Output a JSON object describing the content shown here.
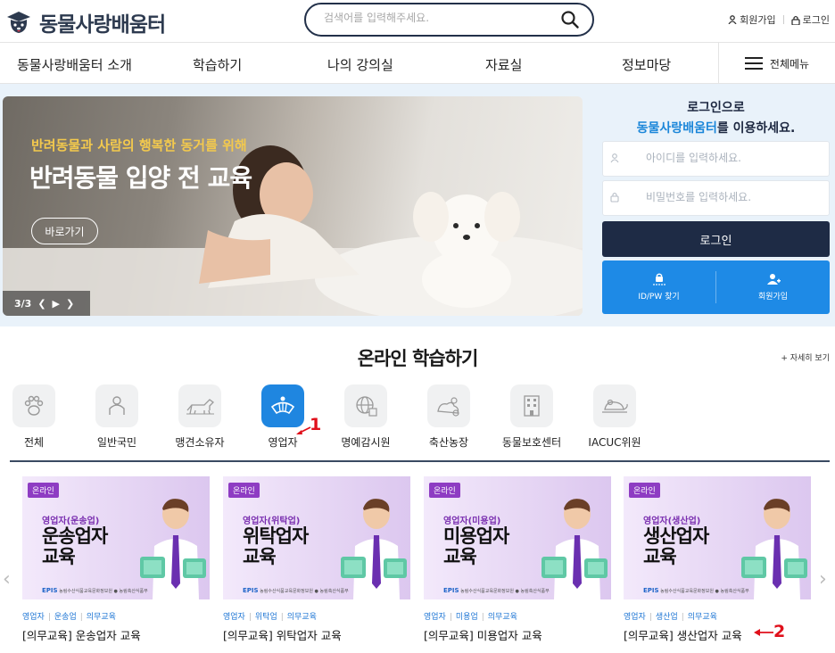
{
  "header": {
    "site_name": "동물사랑배움터",
    "search_placeholder": "검색어를 입력해주세요.",
    "util": [
      {
        "label": "회원가입",
        "icon": "person-icon"
      },
      {
        "label": "로그인",
        "icon": "lock-icon"
      }
    ]
  },
  "gnb": {
    "items": [
      "동물사랑배움터 소개",
      "학습하기",
      "나의 강의실",
      "자료실",
      "정보마당"
    ],
    "all_menu": "전체메뉴"
  },
  "banner": {
    "subtitle": "반려동물과 사람의 행복한 동거를 위해",
    "title": "반려동물 입양 전 교육",
    "go_label": "바로가기",
    "pager": "3/3"
  },
  "login": {
    "heading1": "로그인으로",
    "heading2_brand": "동물사랑배움터",
    "heading2_rest": "를 이용하세요.",
    "id_placeholder": "아이디를 입력하세요.",
    "pw_placeholder": "비밀번호를 입력하세요.",
    "login_button": "로그인",
    "find_label": "ID/PW 찾기",
    "join_label": "회원가입"
  },
  "online": {
    "title": "온라인 학습하기",
    "more": "+ 자세히 보기",
    "categories": [
      {
        "label": "전체",
        "icon": "paw-icon"
      },
      {
        "label": "일반국민",
        "icon": "person-outline-icon"
      },
      {
        "label": "맹견소유자",
        "icon": "dog-icon"
      },
      {
        "label": "영업자",
        "icon": "sale-icon",
        "active": true
      },
      {
        "label": "명예감시원",
        "icon": "globe-icon"
      },
      {
        "label": "축산농장",
        "icon": "farm-animal-icon"
      },
      {
        "label": "동물보호센터",
        "icon": "building-icon"
      },
      {
        "label": "IACUC위원",
        "icon": "lab-mouse-icon"
      }
    ],
    "markers": [
      "1",
      "2"
    ],
    "cards": [
      {
        "badge": "온라인",
        "category": "영업자(운송업)",
        "big1": "운송업자",
        "big2": "교육",
        "tags": [
          "영업자",
          "운송업",
          "의무교육"
        ],
        "title": "[의무교육] 운송업자 교육"
      },
      {
        "badge": "온라인",
        "category": "영업자(위탁업)",
        "big1": "위탁업자",
        "big2": "교육",
        "tags": [
          "영업자",
          "위탁업",
          "의무교육"
        ],
        "title": "[의무교육] 위탁업자 교육"
      },
      {
        "badge": "온라인",
        "category": "영업자(미용업)",
        "big1": "미용업자",
        "big2": "교육",
        "tags": [
          "영업자",
          "미용업",
          "의무교육"
        ],
        "title": "[의무교육] 미용업자 교육"
      },
      {
        "badge": "온라인",
        "category": "영업자(생산업)",
        "big1": "생산업자",
        "big2": "교육",
        "tags": [
          "영업자",
          "생산업",
          "의무교육"
        ],
        "title": "[의무교육] 생산업자 교육"
      }
    ],
    "card_footer": {
      "epis": "EPIS",
      "org": "농림수산식품교육문화정보원",
      "ministry": "농림축산식품부"
    }
  },
  "colors": {
    "navy": "#1e2b45",
    "blue": "#1e8ae6",
    "brand_blue": "#1b86d9",
    "purple_badge": "#8e3cc3",
    "marker_red": "#e0101b"
  }
}
